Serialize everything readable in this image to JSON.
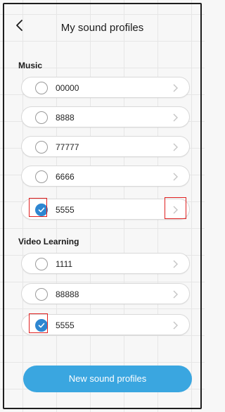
{
  "header": {
    "title": "My sound profiles"
  },
  "sections": [
    {
      "label": "Music",
      "profiles": [
        {
          "name": "00000",
          "selected": false
        },
        {
          "name": "8888",
          "selected": false
        },
        {
          "name": "77777",
          "selected": false
        },
        {
          "name": "6666",
          "selected": false
        },
        {
          "name": "5555",
          "selected": true
        }
      ]
    },
    {
      "label": "Video Learning",
      "profiles": [
        {
          "name": "1111",
          "selected": false
        },
        {
          "name": "88888",
          "selected": false
        },
        {
          "name": "5555",
          "selected": true
        }
      ]
    }
  ],
  "new_button_label": "New sound profiles",
  "colors": {
    "accent": "#2e86d1",
    "button": "#3aa6e0",
    "highlight": "#e02020"
  }
}
